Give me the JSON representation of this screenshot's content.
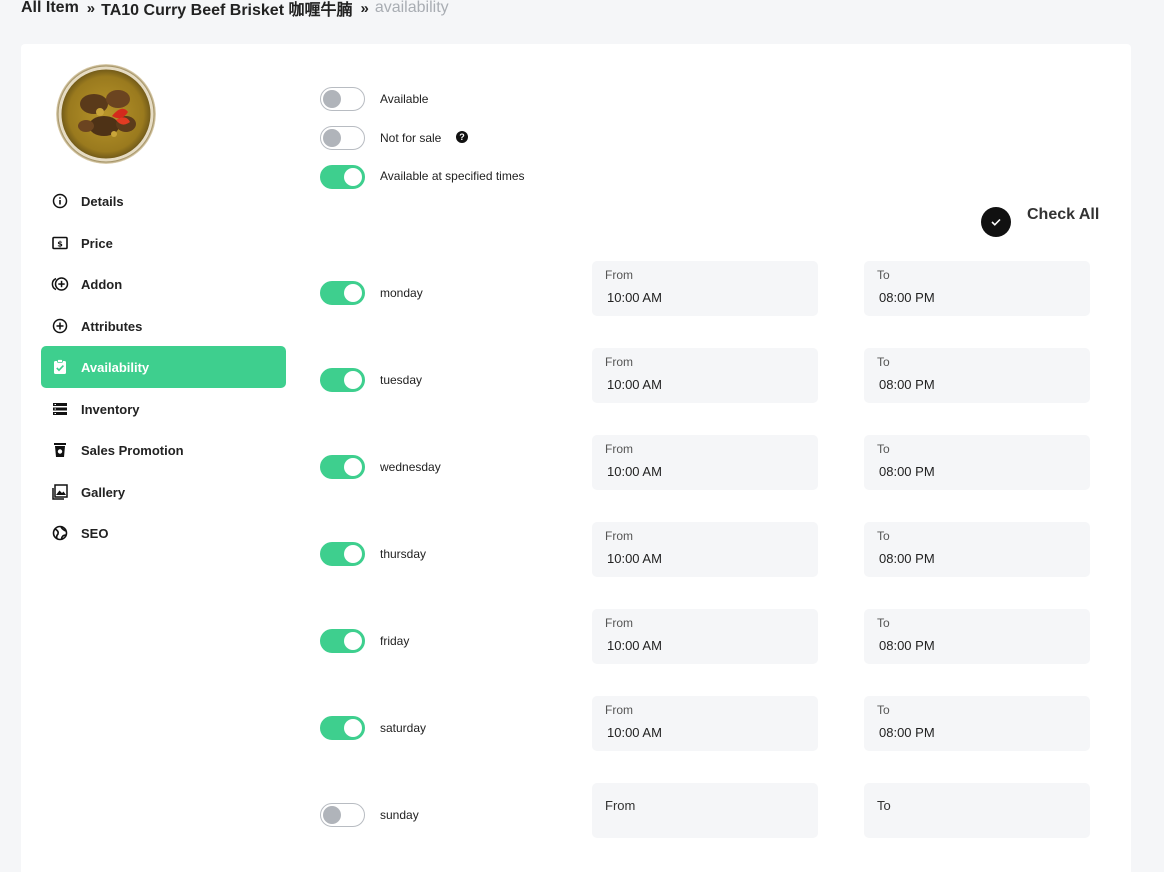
{
  "breadcrumb": {
    "items": [
      "All Item",
      "TA10 Curry Beef Brisket 咖喱牛腩"
    ],
    "separator": "»",
    "current": "availability"
  },
  "sidebar": {
    "items": [
      {
        "label": "Details",
        "icon": "info-icon"
      },
      {
        "label": "Price",
        "icon": "price-tag-icon"
      },
      {
        "label": "Addon",
        "icon": "addon-icon"
      },
      {
        "label": "Attributes",
        "icon": "plus-circle-icon"
      },
      {
        "label": "Availability",
        "icon": "clipboard-check-icon",
        "active": true
      },
      {
        "label": "Inventory",
        "icon": "inventory-icon"
      },
      {
        "label": "Sales Promotion",
        "icon": "cup-icon"
      },
      {
        "label": "Gallery",
        "icon": "gallery-icon"
      },
      {
        "label": "SEO",
        "icon": "globe-icon"
      }
    ]
  },
  "options": {
    "available": {
      "label": "Available",
      "on": false
    },
    "not_for_sale": {
      "label": "Not for sale",
      "on": false,
      "help": "?"
    },
    "specified_times": {
      "label": "Available at specified times",
      "on": true
    }
  },
  "check_all": {
    "label": "Check All"
  },
  "field_labels": {
    "from": "From",
    "to": "To"
  },
  "days": [
    {
      "name": "monday",
      "on": true,
      "from": "10:00 AM",
      "to": "08:00 PM"
    },
    {
      "name": "tuesday",
      "on": true,
      "from": "10:00 AM",
      "to": "08:00 PM"
    },
    {
      "name": "wednesday",
      "on": true,
      "from": "10:00 AM",
      "to": "08:00 PM"
    },
    {
      "name": "thursday",
      "on": true,
      "from": "10:00 AM",
      "to": "08:00 PM"
    },
    {
      "name": "friday",
      "on": true,
      "from": "10:00 AM",
      "to": "08:00 PM"
    },
    {
      "name": "saturday",
      "on": true,
      "from": "10:00 AM",
      "to": "08:00 PM"
    },
    {
      "name": "sunday",
      "on": false,
      "from": "",
      "to": ""
    }
  ],
  "colors": {
    "accent": "#3ecf8e",
    "toggle_off": "#b0b4ba",
    "field_bg": "#f5f6f8"
  }
}
